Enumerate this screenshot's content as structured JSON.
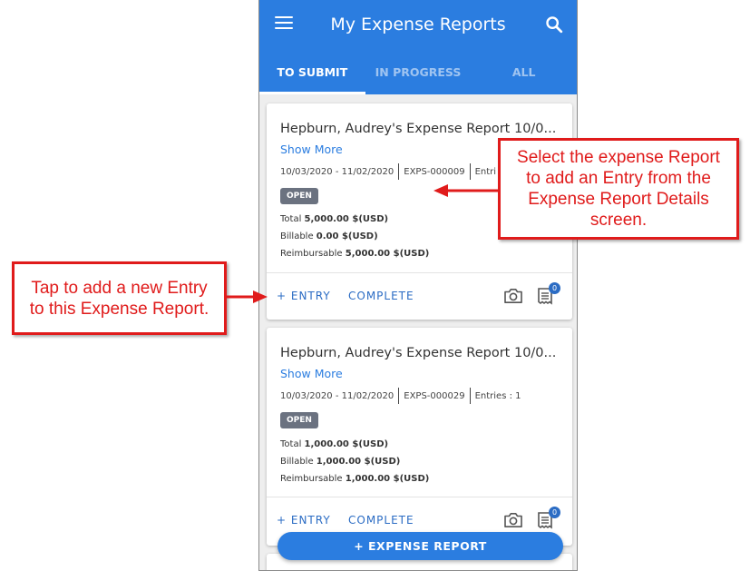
{
  "appbar": {
    "title": "My Expense Reports",
    "tabs": [
      {
        "label": "TO SUBMIT",
        "active": true
      },
      {
        "label": "IN PROGRESS",
        "active": false
      },
      {
        "label": "ALL",
        "active": false
      }
    ]
  },
  "cards": [
    {
      "title": "Hepburn, Audrey's Expense Report 10/0...",
      "show_more": "Show More",
      "date_range": "10/03/2020 - 11/02/2020",
      "report_id": "EXPS-000009",
      "entries": "Entri",
      "status": "OPEN",
      "total_label": "Total",
      "total_value": "5,000.00 $(USD)",
      "billable_label": "Billable",
      "billable_value": "0.00 $(USD)",
      "reimbursable_label": "Reimbursable",
      "reimbursable_value": "5,000.00 $(USD)",
      "entry_action": "+ ENTRY",
      "complete_action": "COMPLETE",
      "receipt_count": "0"
    },
    {
      "title": "Hepburn, Audrey's Expense Report 10/0...",
      "show_more": "Show More",
      "date_range": "10/03/2020 - 11/02/2020",
      "report_id": "EXPS-000029",
      "entries": "Entries : 1",
      "status": "OPEN",
      "total_label": "Total",
      "total_value": "1,000.00 $(USD)",
      "billable_label": "Billable",
      "billable_value": "1,000.00 $(USD)",
      "reimbursable_label": "Reimbursable",
      "reimbursable_value": "1,000.00 $(USD)",
      "entry_action": "+ ENTRY",
      "complete_action": "COMPLETE",
      "receipt_count": "0"
    }
  ],
  "fab_label": "+ EXPENSE REPORT",
  "callouts": {
    "right": [
      "Select the expense Report",
      "to add an Entry from the",
      "Expense Report Details",
      "screen."
    ],
    "left": [
      "Tap to add a new Entry",
      "to this Expense Report."
    ]
  },
  "colors": {
    "primary": "#2b7de0",
    "action": "#2b6cc4",
    "badge": "#6b7280",
    "callout": "#e01b1b"
  }
}
